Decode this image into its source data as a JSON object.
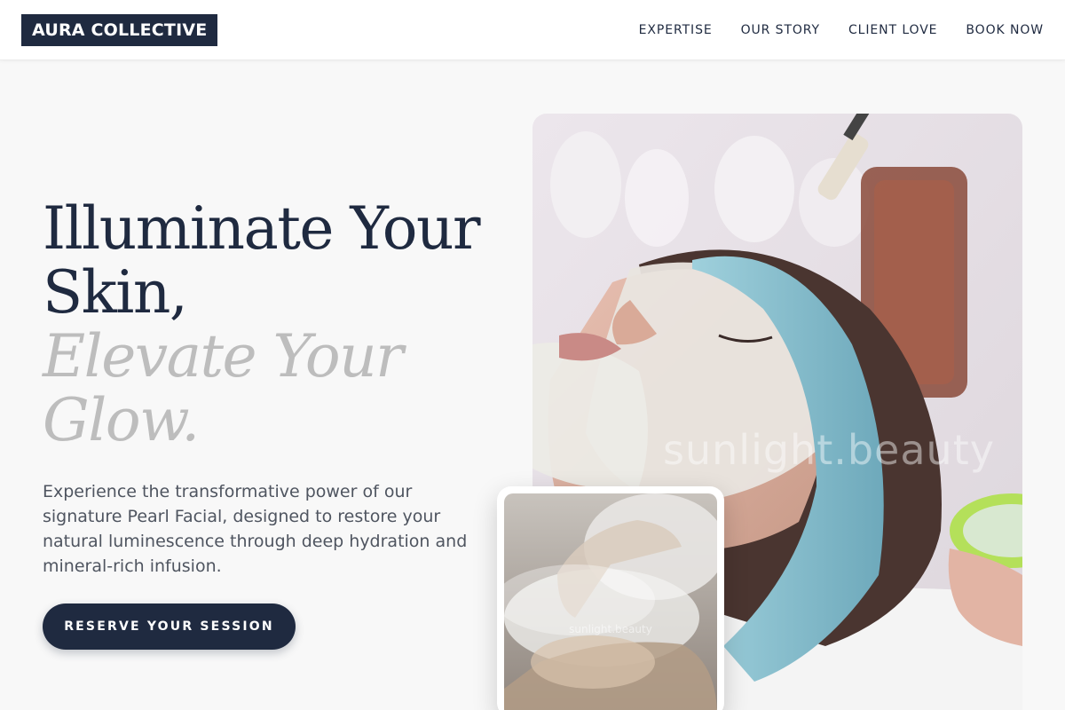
{
  "brand": {
    "logo_text": "AURA COLLECTIVE"
  },
  "nav": {
    "links": [
      {
        "label": "EXPERTISE"
      },
      {
        "label": "OUR STORY"
      },
      {
        "label": "CLIENT LOVE"
      },
      {
        "label": "BOOK NOW"
      }
    ]
  },
  "hero": {
    "headline_line1": "Illuminate Your Skin,",
    "headline_line2": "Elevate Your Glow.",
    "description": "Experience the transformative power of our signature Pearl Facial, designed to restore your natural luminescence through deep hydration and mineral-rich infusion.",
    "cta_label": "RESERVE YOUR SESSION"
  },
  "images": {
    "main": {
      "watermark": "sunlight.beauty"
    },
    "inset": {
      "watermark": "sunlight.beauty"
    }
  },
  "colors": {
    "navy": "#1f2a40",
    "muted_headline": "#bdbdbd",
    "page_background": "#f8f8f8"
  }
}
